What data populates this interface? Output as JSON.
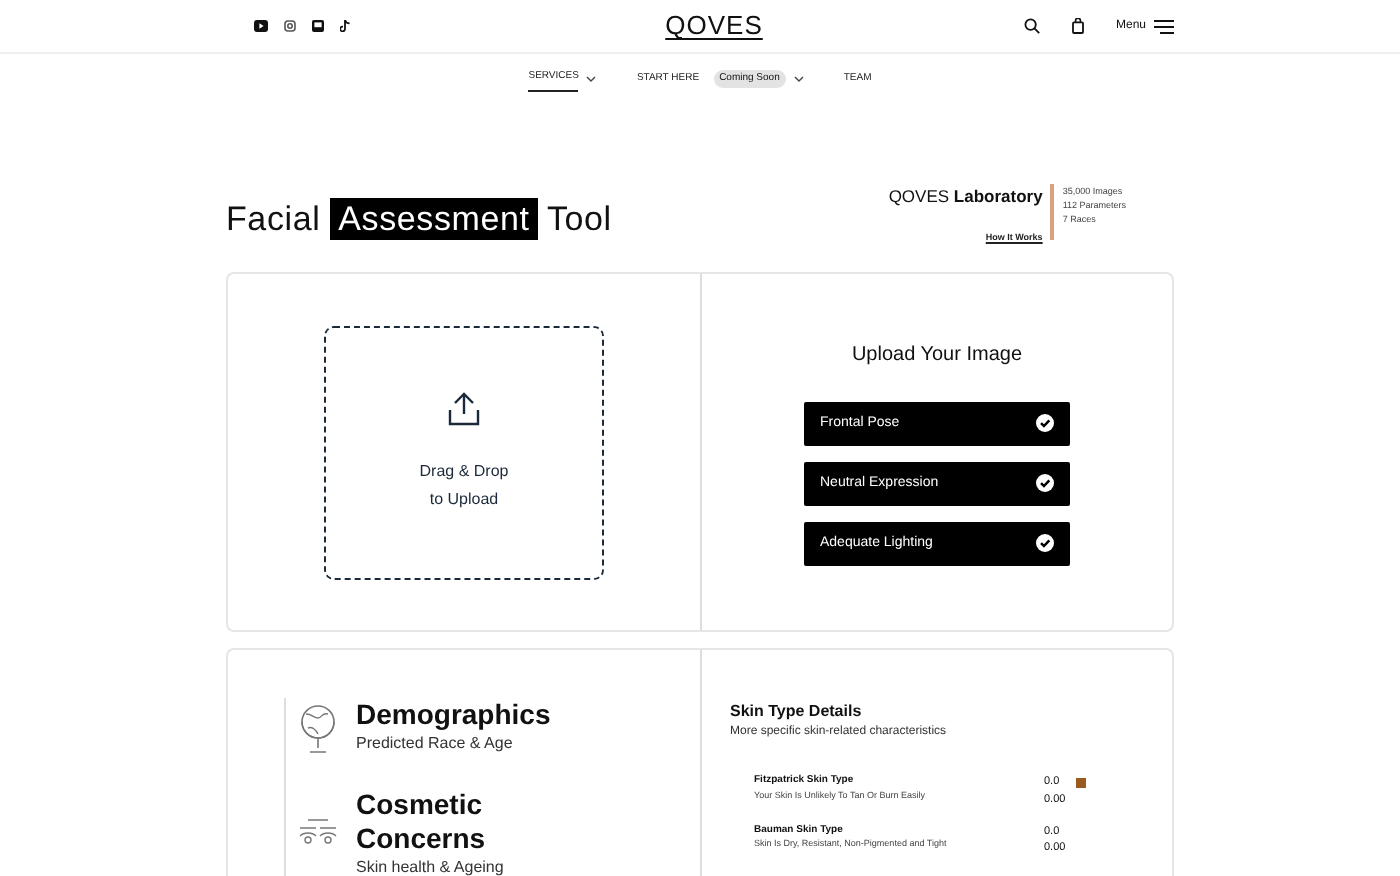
{
  "header": {
    "logo": "QOVES",
    "menu_label": "Menu"
  },
  "nav": [
    {
      "label": "SERVICES",
      "selected": true,
      "dropdown": true
    },
    {
      "label": "START HERE",
      "selected": false,
      "dropdown": true,
      "badge": "Coming Soon"
    },
    {
      "label": "TEAM",
      "selected": false,
      "dropdown": false
    }
  ],
  "title": {
    "before": "Facial",
    "highlight": "Assessment",
    "after": "Tool"
  },
  "lab": {
    "name": "QOVES",
    "name_bold": "Laboratory",
    "link": "How It Works",
    "stats": [
      "35,000 Images",
      "112 Parameters",
      "7 Races"
    ]
  },
  "upload": {
    "drop_text": [
      "Drag & Drop",
      "to Upload"
    ],
    "heading": "Upload Your Image",
    "requirements": [
      {
        "label": "Frontal Pose",
        "checked": true
      },
      {
        "label": "Neutral Expression",
        "checked": true
      },
      {
        "label": "Adequate Lighting",
        "checked": true
      }
    ]
  },
  "categories": [
    {
      "kind": "globe",
      "title": "Demographics",
      "subtitle": "Predicted Race & Age"
    },
    {
      "kind": "eyes",
      "title": "Cosmetic Concerns",
      "subtitle": "Skin health & Ageing"
    }
  ],
  "skin": {
    "heading": "Skin Type Details",
    "subheading": "More specific skin-related characteristics",
    "rows": [
      {
        "name": "Fitzpatrick Skin Type",
        "description": "Your Skin Is Unlikely To Tan Or Burn Easily",
        "score": "0.0",
        "value": "0.00",
        "color": "#9a5a1e"
      },
      {
        "name": "Bauman Skin Type",
        "description": "Skin Is Dry, Resistant, Non-Pigmented and Tight",
        "score": "0.0",
        "value": "0.00"
      }
    ]
  }
}
